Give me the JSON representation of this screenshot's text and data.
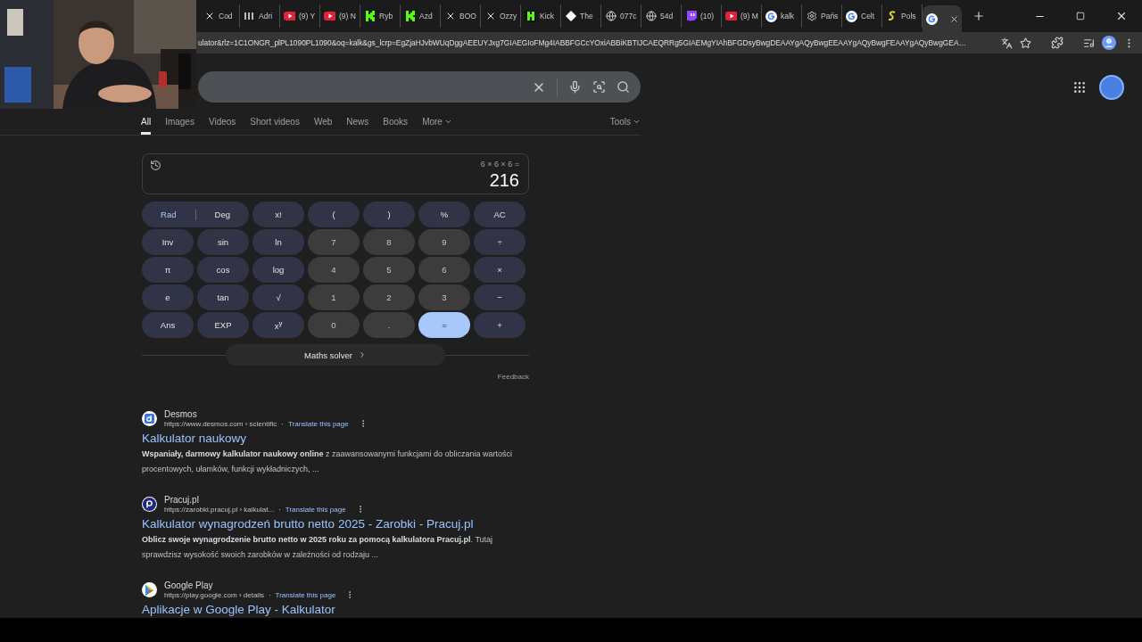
{
  "browser": {
    "tabs": [
      {
        "title": "Cod",
        "kind": "x",
        "selected": false
      },
      {
        "title": "Adri",
        "kind": "bars",
        "selected": false
      },
      {
        "title": "(9) Y",
        "kind": "youtube",
        "selected": false
      },
      {
        "title": "(9) N",
        "kind": "youtube",
        "selected": false
      },
      {
        "title": "Ryb",
        "kind": "kick",
        "selected": false
      },
      {
        "title": "Azd",
        "kind": "kick",
        "selected": false
      },
      {
        "title": "BOO",
        "kind": "x",
        "selected": false
      },
      {
        "title": "Ozzy",
        "kind": "x",
        "selected": false
      },
      {
        "title": "Kick",
        "kind": "kickbox",
        "selected": false
      },
      {
        "title": "The",
        "kind": "diamond",
        "selected": false
      },
      {
        "title": "077c",
        "kind": "globe",
        "selected": false
      },
      {
        "title": "54d",
        "kind": "globe",
        "selected": false
      },
      {
        "title": "(10)",
        "kind": "twitch",
        "selected": false
      },
      {
        "title": "(9) M",
        "kind": "youtube",
        "selected": false
      },
      {
        "title": "kalk",
        "kind": "google",
        "selected": false
      },
      {
        "title": "Pańs",
        "kind": "gear",
        "selected": false
      },
      {
        "title": "Celt",
        "kind": "google",
        "selected": false
      },
      {
        "title": "Pols",
        "kind": "swirl",
        "selected": false
      },
      {
        "kind": "google",
        "selected": true
      }
    ],
    "url": "ulator&rlz=1C1ONGR_plPL1090PL1090&oq=kalk&gs_lcrp=EgZjaHJvbWUqDggAEEUYJxg7GIAEGIoFMg4IABBFGCcYOxiABBiKBTIJCAEQRRg5GIAEMgYIAhBFGDsyBwgDEAAYgAQyBwgEEAAYgAQyBwgFEAAYgAQyBwgGEA…"
  },
  "search_tabs": [
    {
      "label": "All",
      "selected": true
    },
    {
      "label": "Images",
      "selected": false
    },
    {
      "label": "Videos",
      "selected": false
    },
    {
      "label": "Short videos",
      "selected": false
    },
    {
      "label": "Web",
      "selected": false
    },
    {
      "label": "News",
      "selected": false
    },
    {
      "label": "Books",
      "selected": false
    },
    {
      "label": "More",
      "selected": false
    }
  ],
  "tools": "Tools",
  "calculator": {
    "expression": "6 × 6 × 6 =",
    "result": "216",
    "modes": [
      {
        "label": "Rad",
        "selected": true
      },
      {
        "label": "Deg",
        "selected": false
      }
    ],
    "keys": [
      {
        "label": "x!",
        "kind": "func"
      },
      {
        "label": "(",
        "kind": "func"
      },
      {
        "label": ")",
        "kind": "func"
      },
      {
        "label": "%",
        "kind": "func"
      },
      {
        "label": "AC",
        "kind": "func"
      },
      {
        "label": "Inv",
        "kind": "func"
      },
      {
        "label": "sin",
        "kind": "func"
      },
      {
        "label": "ln",
        "kind": "func"
      },
      {
        "label": "7",
        "kind": "digit"
      },
      {
        "label": "8",
        "kind": "digit"
      },
      {
        "label": "9",
        "kind": "digit"
      },
      {
        "label": "÷",
        "kind": "func"
      },
      {
        "label": "π",
        "kind": "func"
      },
      {
        "label": "cos",
        "kind": "func"
      },
      {
        "label": "log",
        "kind": "func"
      },
      {
        "label": "4",
        "kind": "digit"
      },
      {
        "label": "5",
        "kind": "digit"
      },
      {
        "label": "6",
        "kind": "digit"
      },
      {
        "label": "×",
        "kind": "func"
      },
      {
        "label": "e",
        "kind": "func"
      },
      {
        "label": "tan",
        "kind": "func"
      },
      {
        "label": "√",
        "kind": "func"
      },
      {
        "label": "1",
        "kind": "digit"
      },
      {
        "label": "2",
        "kind": "digit"
      },
      {
        "label": "3",
        "kind": "digit"
      },
      {
        "label": "−",
        "kind": "func"
      },
      {
        "label": "Ans",
        "kind": "func"
      },
      {
        "label": "EXP",
        "kind": "func"
      },
      {
        "label": "x$^{y}$",
        "kind": "func"
      },
      {
        "label": "0",
        "kind": "digit"
      },
      {
        "label": ".",
        "kind": "digit"
      },
      {
        "label": "=",
        "kind": "equals"
      },
      {
        "label": "+",
        "kind": "func"
      }
    ],
    "solver": "Maths solver",
    "feedback": "Feedback"
  },
  "results": [
    {
      "kind": "desmos",
      "site": "Desmos",
      "url": "https://www.desmos.com › scientific",
      "separator": "·",
      "translate": "Translate this page",
      "title": "Kalkulator naukowy",
      "snippet": "**Wspaniały, darmowy kalkulator naukowy online** z zaawansowanymi funkcjami do obliczania wartości procentowych, ułamków, funkcji wykładniczych, ..."
    },
    {
      "kind": "pracuj",
      "site": "Pracuj.pl",
      "url": "https://zarobki.pracuj.pl › kalkulat...",
      "separator": "·",
      "translate": "Translate this page",
      "title": "Kalkulator wynagrodzeń brutto netto 2025 - Zarobki - Pracuj.pl",
      "snippet": "**Oblicz swoje wynagrodzenie brutto netto w 2025 roku za pomocą kalkulatora Pracuj.pl**. Tutaj sprawdzisz wysokość swoich zarobków w zależności od rodzaju ..."
    },
    {
      "kind": "play",
      "site": "Google Play",
      "url": "https://play.google.com › details",
      "separator": "·",
      "translate": "Translate this page",
      "title": "Aplikacje w Google Play - Kalkulator"
    }
  ]
}
